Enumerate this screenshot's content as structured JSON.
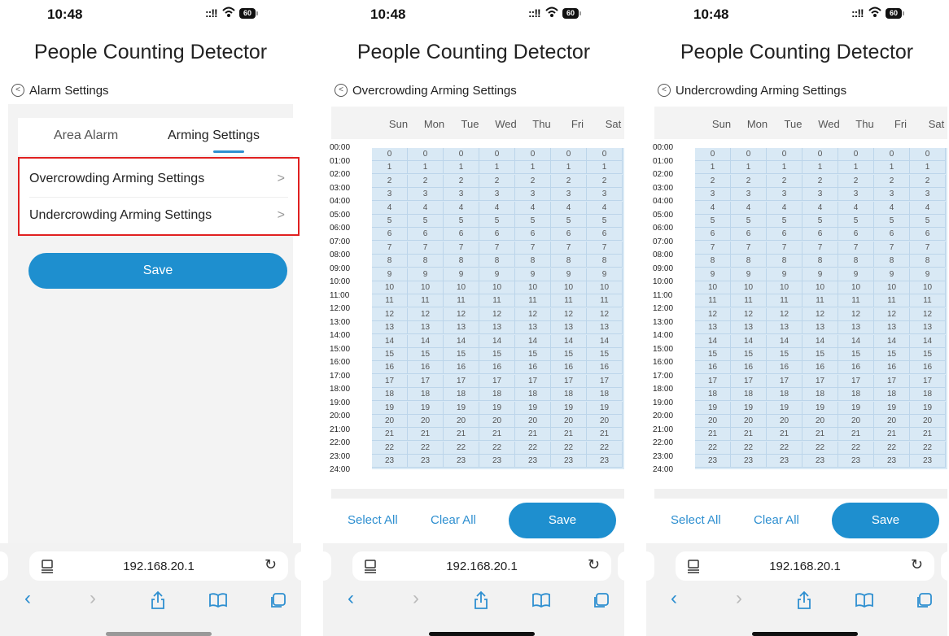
{
  "status": {
    "time": "10:48",
    "battery": "60"
  },
  "app_title": "People Counting Detector",
  "screen1": {
    "back_label": "Alarm Settings",
    "tabs": [
      "Area Alarm",
      "Arming Settings"
    ],
    "menu": [
      "Overcrowding Arming Settings",
      "Undercrowding Arming Settings"
    ],
    "save_label": "Save"
  },
  "screen2": {
    "back_label": "Overcrowding Arming Settings"
  },
  "screen3": {
    "back_label": "Undercrowding Arming Settings"
  },
  "schedule": {
    "days": [
      "Sun",
      "Mon",
      "Tue",
      "Wed",
      "Thu",
      "Fri",
      "Sat"
    ],
    "hour_labels": [
      "00:00",
      "01:00",
      "02:00",
      "03:00",
      "04:00",
      "05:00",
      "06:00",
      "07:00",
      "08:00",
      "09:00",
      "10:00",
      "11:00",
      "12:00",
      "13:00",
      "14:00",
      "15:00",
      "16:00",
      "17:00",
      "18:00",
      "19:00",
      "20:00",
      "21:00",
      "22:00",
      "23:00",
      "24:00"
    ],
    "hours": [
      "0",
      "1",
      "2",
      "3",
      "4",
      "5",
      "6",
      "7",
      "8",
      "9",
      "10",
      "11",
      "12",
      "13",
      "14",
      "15",
      "16",
      "17",
      "18",
      "19",
      "20",
      "21",
      "22",
      "23"
    ],
    "select_all": "Select All",
    "clear_all": "Clear All",
    "save_label": "Save",
    "highlight_color": "#d9e9f5"
  },
  "browser": {
    "url": "192.168.20.1"
  },
  "colors": {
    "accent": "#1e8fcf",
    "highlight_box": "#e02020"
  }
}
